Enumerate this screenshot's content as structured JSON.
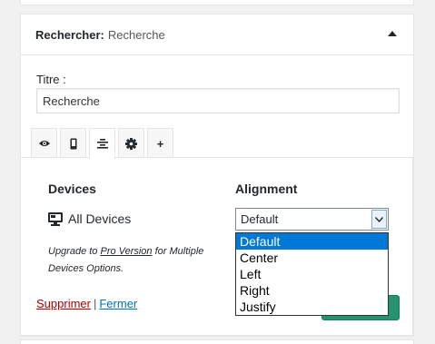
{
  "widget": {
    "title_strong": "Rechercher:",
    "title_sub": "Recherche"
  },
  "form": {
    "title_label": "Titre :",
    "title_value": "Recherche"
  },
  "tabs": [
    {
      "icon": "eye-icon"
    },
    {
      "icon": "mobile-device-icon"
    },
    {
      "icon": "align-center-icon"
    },
    {
      "icon": "gear-icon"
    },
    {
      "icon": "plus-icon",
      "label": "+"
    }
  ],
  "visibility": {
    "devices_heading": "Devices",
    "alignment_heading": "Alignment",
    "devices_value": "All Devices",
    "alignment_selected": "Default",
    "alignment_options": [
      "Default",
      "Center",
      "Left",
      "Right",
      "Justify"
    ],
    "upgrade_prefix": "Upgrade to ",
    "upgrade_link": "Pro Version",
    "upgrade_suffix": " for Multiple Devices Options."
  },
  "actions": {
    "delete_label": "Supprimer",
    "separator": "|",
    "close_label": "Fermer"
  },
  "colors": {
    "save_button": "#26936e",
    "delete_link": "#aa0000",
    "close_link": "#0073aa",
    "dropdown_highlight": "#0078d7"
  }
}
